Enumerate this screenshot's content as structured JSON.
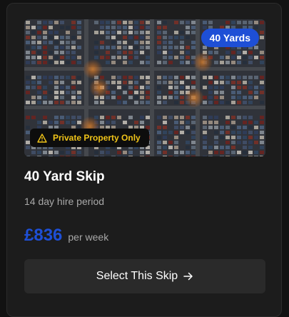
{
  "card": {
    "size_badge": "40 Yards",
    "warning": "Private Property Only",
    "title": "40 Yard Skip",
    "hire_period": "14 day hire period",
    "price": "£836",
    "price_unit": "per week",
    "button_label": "Select This Skip"
  },
  "icons": {
    "warning": "warning-triangle-icon",
    "arrow": "arrow-right-icon"
  },
  "colors": {
    "accent": "#1e4fd6",
    "warning": "#f0c419",
    "card_bg": "#1c1c1c"
  }
}
